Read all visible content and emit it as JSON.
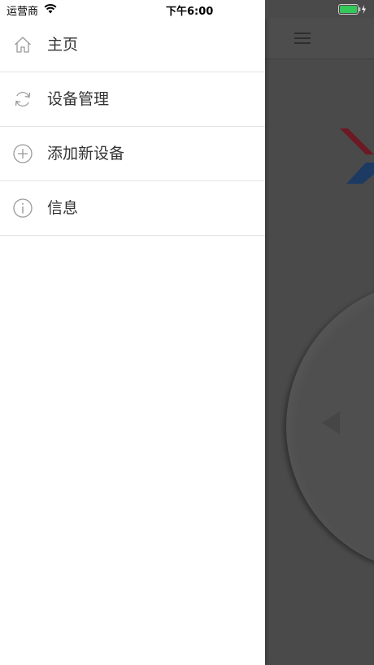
{
  "status_bar": {
    "carrier": "运营商",
    "time": "下午6:00"
  },
  "drawer": {
    "items": [
      {
        "label": "主页",
        "icon": "home-icon"
      },
      {
        "label": "设备管理",
        "icon": "refresh-icon"
      },
      {
        "label": "添加新设备",
        "icon": "add-circle-icon"
      },
      {
        "label": "信息",
        "icon": "info-icon"
      }
    ]
  },
  "colors": {
    "battery": "#34c759",
    "overlay": "#4a4a4a",
    "icon": "#9a9a9a",
    "text": "#333333"
  }
}
